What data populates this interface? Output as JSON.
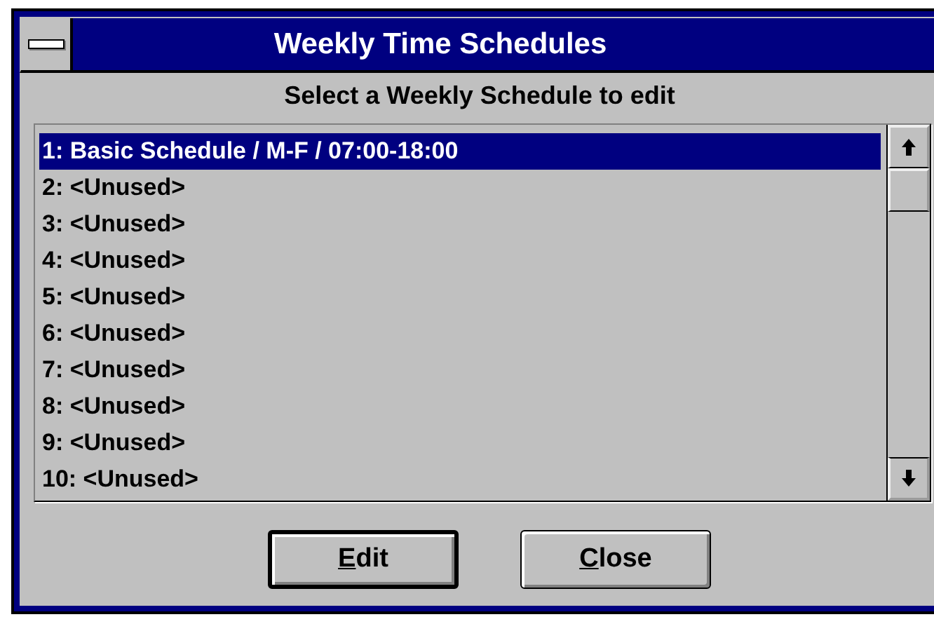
{
  "window": {
    "title": "Weekly Time Schedules"
  },
  "prompt": "Select a Weekly Schedule to edit",
  "schedules": [
    {
      "label": "1: Basic Schedule / M-F / 07:00-18:00",
      "selected": true
    },
    {
      "label": "2: <Unused>",
      "selected": false
    },
    {
      "label": "3: <Unused>",
      "selected": false
    },
    {
      "label": "4: <Unused>",
      "selected": false
    },
    {
      "label": "5: <Unused>",
      "selected": false
    },
    {
      "label": "6: <Unused>",
      "selected": false
    },
    {
      "label": "7: <Unused>",
      "selected": false
    },
    {
      "label": "8: <Unused>",
      "selected": false
    },
    {
      "label": "9: <Unused>",
      "selected": false
    },
    {
      "label": "10: <Unused>",
      "selected": false
    }
  ],
  "buttons": [
    {
      "label": "Edit",
      "default": true,
      "underline_first": true
    },
    {
      "label": "Close",
      "default": false,
      "underline_first": true
    }
  ]
}
